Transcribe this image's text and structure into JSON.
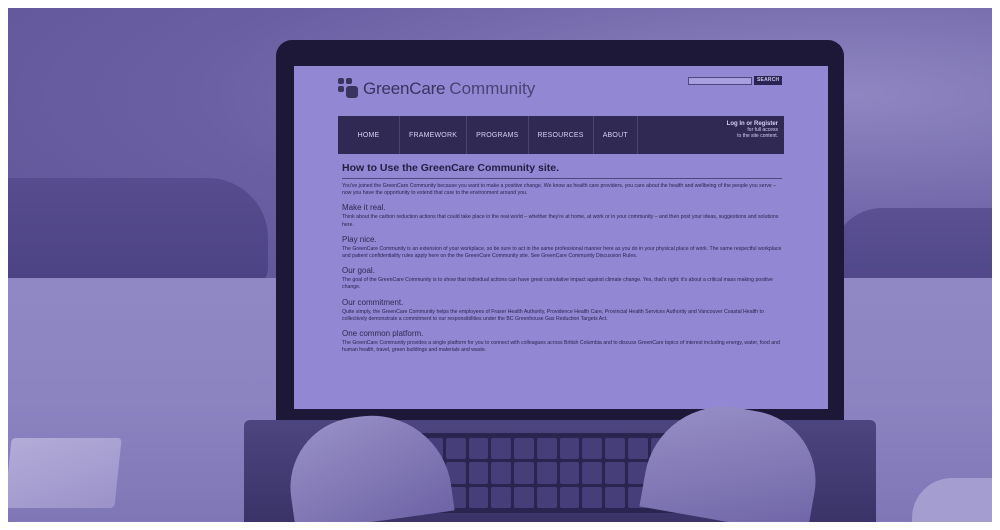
{
  "site": {
    "logo_main": "GreenCare",
    "logo_sub": "Community",
    "search_button": "SEARCH",
    "nav": [
      "HOME",
      "FRAMEWORK",
      "PROGRAMS",
      "RESOURCES",
      "ABOUT"
    ],
    "login_text": "Log In or Register",
    "login_note_1": "for full access",
    "login_note_2": "to the site content.",
    "page_title": "How to Use the GreenCare Community site.",
    "intro": "You've joined the GreenCare Community because you want to make a positive change. We know as health care providers, you care about the health and wellbeing of the people you serve – now you have the opportunity to extend that care to the environment around you.",
    "sections": [
      {
        "title": "Make it real.",
        "text": "Think about the carbon reduction actions that could take place in the real world – whether they're at home, at work or in your community – and then post your ideas, suggestions and solutions here."
      },
      {
        "title": "Play nice.",
        "text": "The GreenCare Community is an extension of your workplace, so be sure to act in the same professional manner here as you do in your physical place of work. The same respectful workplace and patient confidentiality rules apply here on the the GreenCare Community site. See GreenCare Community Discussion Rules."
      },
      {
        "title": "Our goal.",
        "text": "The goal of the GreenCare Community is to show that individual actions can have great cumulative impact against climate change. Yes, that's right: it's about a critical mass making positive change."
      },
      {
        "title": "Our commitment.",
        "text": "Quite simply, the GreenCare Community helps the employees of Fraser Health Authority, Providence Health Care, Provincial Health Services Authority and Vancouver Coastal Health to collectively demonstrate a commitment to our responsibilities under the BC Greenhouse Gas Reduction Targets Act."
      },
      {
        "title": "One common platform.",
        "text": "The GreenCare Community provides a single platform for you to connect with colleagues across British Columbia and to discuss GreenCare topics of interest including energy, water, food and human health, travel, green buildings and materials and waste."
      }
    ]
  }
}
